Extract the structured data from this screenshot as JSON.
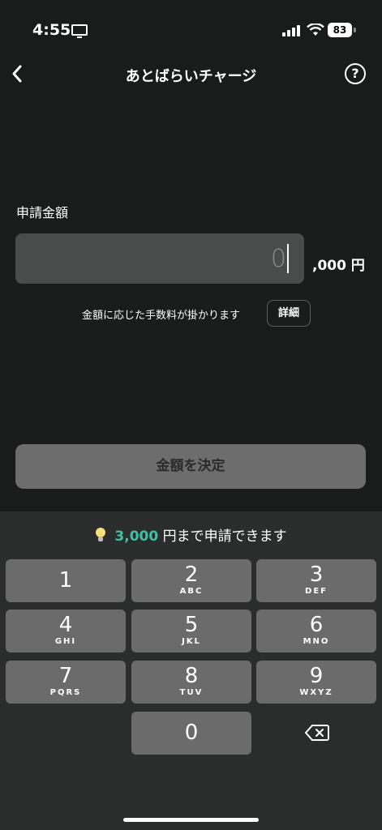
{
  "status_bar": {
    "time": "4:55",
    "battery": "83"
  },
  "nav": {
    "title": "あとばらいチャージ",
    "help_icon": "?"
  },
  "form": {
    "field_label": "申請金額",
    "amount_value": "0",
    "amount_suffix": ",000 円",
    "fee_note": "金額に応じた手数料が掛かります",
    "detail_label": "詳細",
    "decide_label": "金額を決定"
  },
  "limit": {
    "amount": "3,000",
    "text": " 円まで申請できます"
  },
  "keypad": {
    "keys": [
      {
        "digit": "1",
        "letters": ""
      },
      {
        "digit": "2",
        "letters": "ABC"
      },
      {
        "digit": "3",
        "letters": "DEF"
      },
      {
        "digit": "4",
        "letters": "GHI"
      },
      {
        "digit": "5",
        "letters": "JKL"
      },
      {
        "digit": "6",
        "letters": "MNO"
      },
      {
        "digit": "7",
        "letters": "PQRS"
      },
      {
        "digit": "8",
        "letters": "TUV"
      },
      {
        "digit": "9",
        "letters": "WXYZ"
      },
      {
        "digit": "0",
        "letters": ""
      }
    ]
  },
  "colors": {
    "background": "#1a1c1b",
    "accent": "#3cc3a6",
    "key": "#6b6b6b"
  }
}
